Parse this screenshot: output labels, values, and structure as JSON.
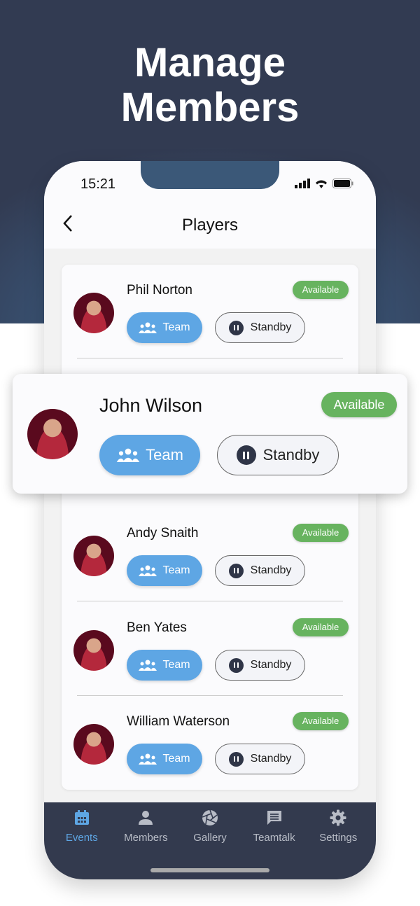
{
  "headline": [
    "Manage",
    "Members"
  ],
  "status_bar": {
    "time": "15:21"
  },
  "header": {
    "title": "Players",
    "back_icon": "chevron-left-icon"
  },
  "players": [
    {
      "name": "Phil Norton",
      "status": "Available",
      "team_label": "Team",
      "standby_label": "Standby"
    },
    {
      "name": "John Wilson",
      "status": "Available",
      "team_label": "Team",
      "standby_label": "Standby"
    },
    {
      "name": "Andy Snaith",
      "status": "Available",
      "team_label": "Team",
      "standby_label": "Standby"
    },
    {
      "name": "Ben Yates",
      "status": "Available",
      "team_label": "Team",
      "standby_label": "Standby"
    },
    {
      "name": "William Waterson",
      "status": "Available",
      "team_label": "Team",
      "standby_label": "Standby"
    }
  ],
  "nav": [
    {
      "label": "Events",
      "icon": "calendar-icon",
      "active": true
    },
    {
      "label": "Members",
      "icon": "person-icon"
    },
    {
      "label": "Gallery",
      "icon": "aperture-icon"
    },
    {
      "label": "Teamtalk",
      "icon": "chat-icon"
    },
    {
      "label": "Settings",
      "icon": "gear-icon"
    }
  ],
  "colors": {
    "accent": "#5ea6e4",
    "available": "#67b35f",
    "nav_bg": "#333a4e"
  }
}
